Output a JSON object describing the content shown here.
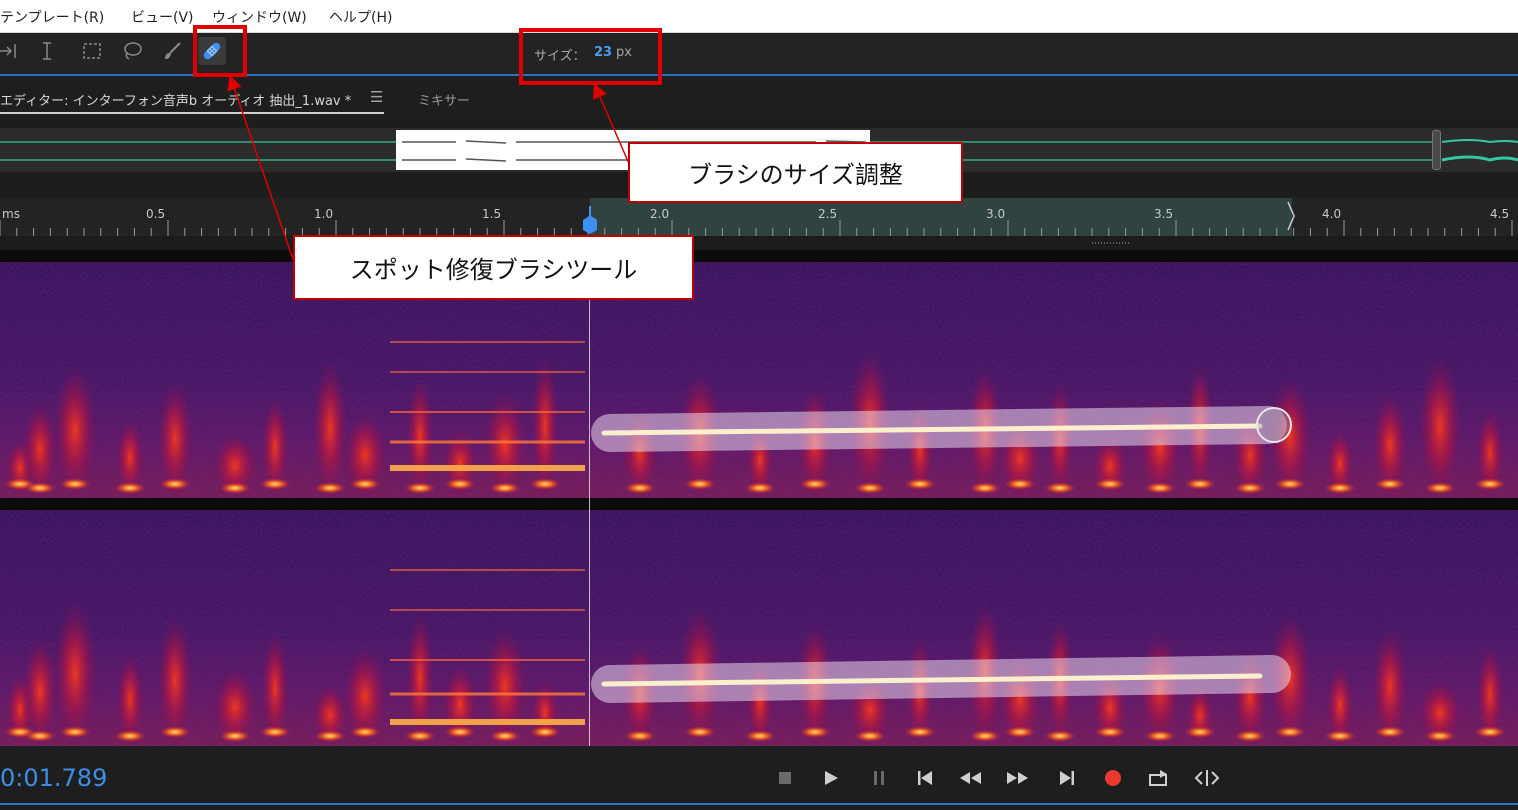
{
  "menu": {
    "items": [
      {
        "label": "テンプレート(R)"
      },
      {
        "label": "ビュー(V)"
      },
      {
        "label": "ウィンドウ(W)"
      },
      {
        "label": "ヘルプ(H)"
      }
    ]
  },
  "toolbar": {
    "tools": [
      {
        "icon": "move-tool-icon"
      },
      {
        "icon": "time-selection-tool-icon"
      },
      {
        "icon": "marquee-selection-tool-icon"
      },
      {
        "icon": "lasso-selection-tool-icon"
      },
      {
        "icon": "paintbrush-selection-tool-icon"
      },
      {
        "icon": "spot-healing-brush-tool-icon",
        "active": true
      }
    ],
    "size_label": "サイズ：",
    "size_value": "23",
    "size_unit": "px"
  },
  "tabs": {
    "editor": "エディター: インターフォン音声b オーディオ 抽出_1.wav *",
    "menu_icon": "☰",
    "mixer": "ミキサー"
  },
  "ruler": {
    "labels": [
      "ms",
      "0.5",
      "1.0",
      "1.5",
      "2.0",
      "2.5",
      "3.0",
      "3.5",
      "4.0",
      "4.5"
    ]
  },
  "transport": {
    "timecode": "0:01.789",
    "buttons": [
      {
        "icon": "stop-icon"
      },
      {
        "icon": "play-icon"
      },
      {
        "icon": "pause-icon"
      },
      {
        "icon": "go-to-start-icon"
      },
      {
        "icon": "rewind-icon"
      },
      {
        "icon": "fast-forward-icon"
      },
      {
        "icon": "go-to-end-icon"
      },
      {
        "icon": "record-icon"
      },
      {
        "icon": "loop-playback-icon"
      },
      {
        "icon": "skip-selection-icon"
      }
    ]
  },
  "annotations": {
    "brush_size": "ブラシのサイズ調整",
    "spot_heal": "スポット修復ブラシツール"
  },
  "colors": {
    "accent": "#2a72c9",
    "timecode": "#3c8fe8",
    "size_value": "#4b9cf5",
    "record": "#e8392f",
    "annotation_red": "#e00000"
  }
}
